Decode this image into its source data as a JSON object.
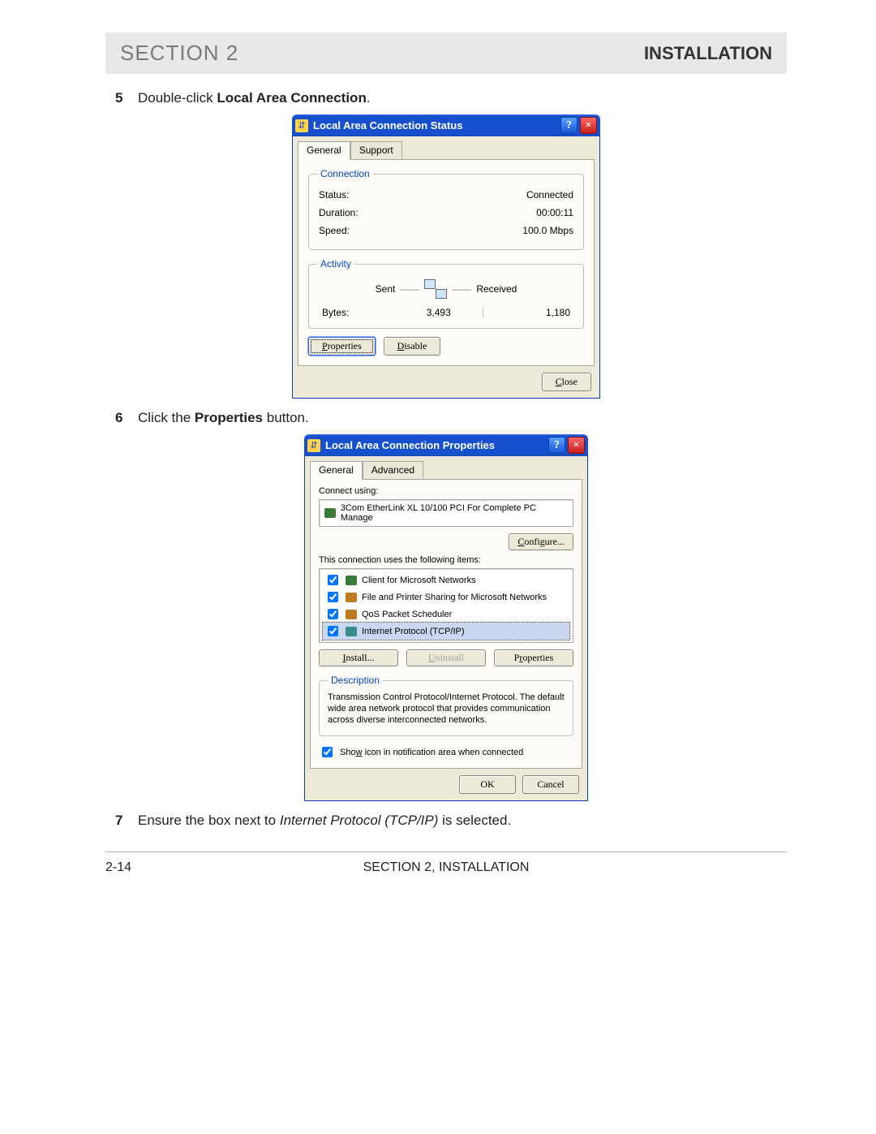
{
  "header": {
    "left": "SECTION 2",
    "right": "INSTALLATION"
  },
  "steps": {
    "s5": {
      "num": "5",
      "pre": "Double-click ",
      "bold": "Local Area Connection",
      "post": "."
    },
    "s6": {
      "num": "6",
      "pre": "Click the ",
      "bold": "Properties",
      "post": " button."
    },
    "s7": {
      "num": "7",
      "pre": "Ensure the box next to ",
      "italic": "Internet Protocol (TCP/IP)",
      "post": " is selected."
    }
  },
  "dialog1": {
    "title": "Local Area Connection Status",
    "tabs": {
      "general": "General",
      "support": "Support"
    },
    "connection": {
      "legend": "Connection",
      "status_l": "Status:",
      "status_v": "Connected",
      "duration_l": "Duration:",
      "duration_v": "00:00:11",
      "speed_l": "Speed:",
      "speed_v": "100.0 Mbps"
    },
    "activity": {
      "legend": "Activity",
      "sent": "Sent",
      "received": "Received",
      "bytes_l": "Bytes:",
      "sent_v": "3,493",
      "recv_v": "1,180"
    },
    "buttons": {
      "properties": "Properties",
      "disable": "Disable",
      "close": "Close"
    }
  },
  "dialog2": {
    "title": "Local Area Connection Properties",
    "tabs": {
      "general": "General",
      "advanced": "Advanced"
    },
    "connect_using_l": "Connect using:",
    "adapter": "3Com EtherLink XL 10/100 PCI For Complete PC Manage",
    "configure": "Configure...",
    "items_label": "This connection uses the following items:",
    "items": [
      "Client for Microsoft Networks",
      "File and Printer Sharing for Microsoft Networks",
      "QoS Packet Scheduler",
      "Internet Protocol (TCP/IP)"
    ],
    "install": "Install...",
    "uninstall": "Uninstall",
    "properties": "Properties",
    "desc_legend": "Description",
    "desc_text": "Transmission Control Protocol/Internet Protocol. The default wide area network protocol that provides communication across diverse interconnected networks.",
    "show_icon": "Show icon in notification area when connected",
    "ok": "OK",
    "cancel": "Cancel"
  },
  "footer": {
    "page": "2-14",
    "center": "SECTION 2, INSTALLATION"
  }
}
